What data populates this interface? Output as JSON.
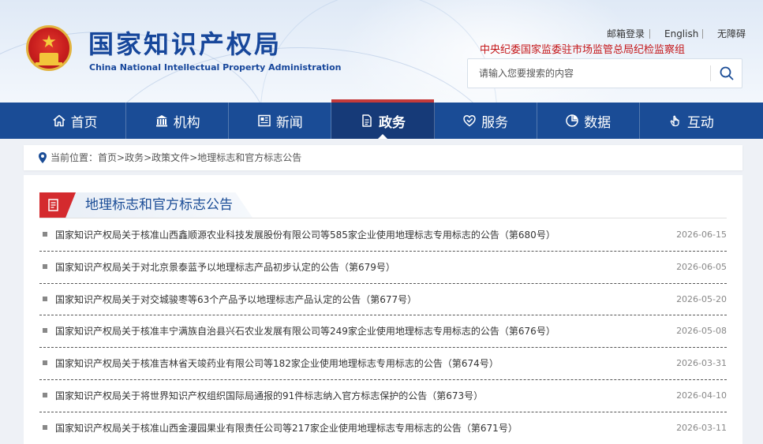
{
  "header": {
    "logo_cn": "国家知识产权局",
    "logo_en": "China National Intellectual Property Administration",
    "links": [
      "邮箱登录",
      "English",
      "无障碍"
    ],
    "discipline_text": "中央纪委国家监委驻市场监管总局纪检监察组",
    "search_placeholder": "请输入您要搜索的内容"
  },
  "nav": {
    "items": [
      {
        "label": "首页",
        "icon": "home-icon"
      },
      {
        "label": "机构",
        "icon": "institution-icon"
      },
      {
        "label": "新闻",
        "icon": "news-icon"
      },
      {
        "label": "政务",
        "icon": "government-doc-icon"
      },
      {
        "label": "服务",
        "icon": "service-icon"
      },
      {
        "label": "数据",
        "icon": "data-pie-icon"
      },
      {
        "label": "互动",
        "icon": "interaction-hand-icon"
      }
    ],
    "active_index": 3
  },
  "breadcrumb": {
    "prefix": "当前位置：",
    "items": [
      "首页",
      "政务",
      "政策文件",
      "地理标志和官方标志公告"
    ]
  },
  "section": {
    "title": "地理标志和官方标志公告"
  },
  "list": [
    {
      "title": "国家知识产权局关于核准山西鑫顺源农业科技发展股份有限公司等585家企业使用地理标志专用标志的公告（第680号）",
      "date": "2026-06-15"
    },
    {
      "title": "国家知识产权局关于对北京景泰蓝予以地理标志产品初步认定的公告（第679号）",
      "date": "2026-06-05"
    },
    {
      "title": "国家知识产权局关于对交城骏枣等63个产品予以地理标志产品认定的公告（第677号）",
      "date": "2026-05-20"
    },
    {
      "title": "国家知识产权局关于核准丰宁满族自治县兴石农业发展有限公司等249家企业使用地理标志专用标志的公告（第676号）",
      "date": "2026-05-08"
    },
    {
      "title": "国家知识产权局关于核准吉林省天竣药业有限公司等182家企业使用地理标志专用标志的公告（第674号）",
      "date": "2026-03-31"
    },
    {
      "title": "国家知识产权局关于将世界知识产权组织国际局通报的91件标志纳入官方标志保护的公告（第673号）",
      "date": "2026-04-10"
    },
    {
      "title": "国家知识产权局关于核准山西金漫园果业有限责任公司等217家企业使用地理标志专用标志的公告（第671号）",
      "date": "2026-03-11"
    }
  ],
  "colors": {
    "nav_bg": "#1a4c96",
    "brand_blue": "#17479b",
    "accent_red": "#d42a2e",
    "discipline_red": "#c4171a"
  }
}
